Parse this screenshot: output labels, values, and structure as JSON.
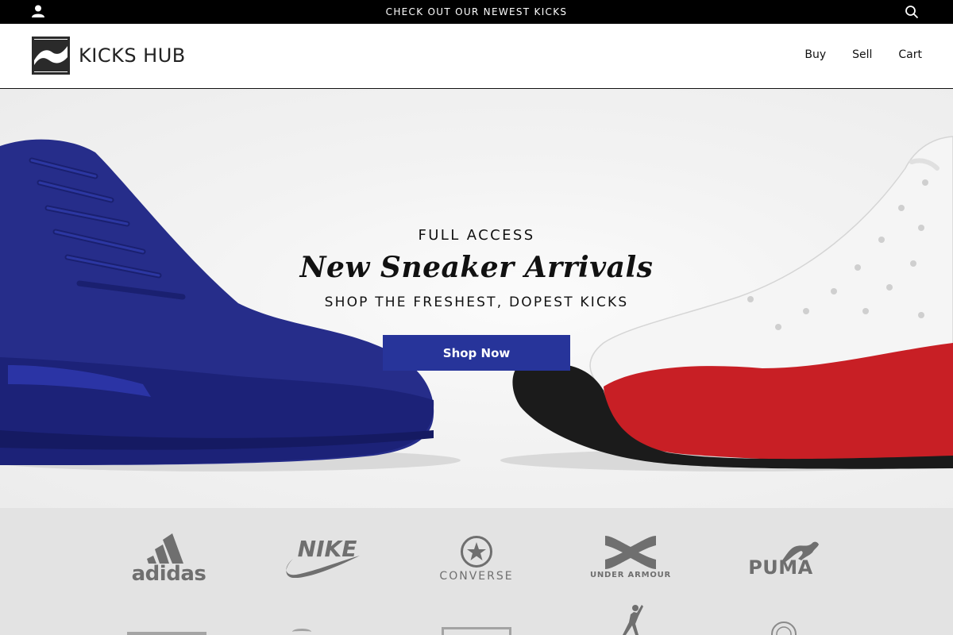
{
  "announcement": {
    "text": "CHECK OUT OUR NEWEST KICKS"
  },
  "header": {
    "logo_text": "KICKS HUB",
    "nav": [
      {
        "label": "Buy"
      },
      {
        "label": "Sell"
      },
      {
        "label": "Cart"
      }
    ]
  },
  "hero": {
    "kicker": "FULL ACCESS",
    "title": "New Sneaker Arrivals",
    "subtitle": "SHOP THE FRESHEST, DOPEST KICKS",
    "cta_label": "Shop Now",
    "cta_color": "#27349a"
  },
  "brands": {
    "row1": [
      {
        "name": "adidas"
      },
      {
        "name": "NIKE"
      },
      {
        "name": "CONVERSE"
      },
      {
        "name": "UNDER ARMOUR"
      },
      {
        "name": "PUMA"
      }
    ]
  },
  "colors": {
    "bar": "#000000",
    "brand_strip": "#e3e3e3",
    "logo_gray": "#6f6f6f"
  }
}
